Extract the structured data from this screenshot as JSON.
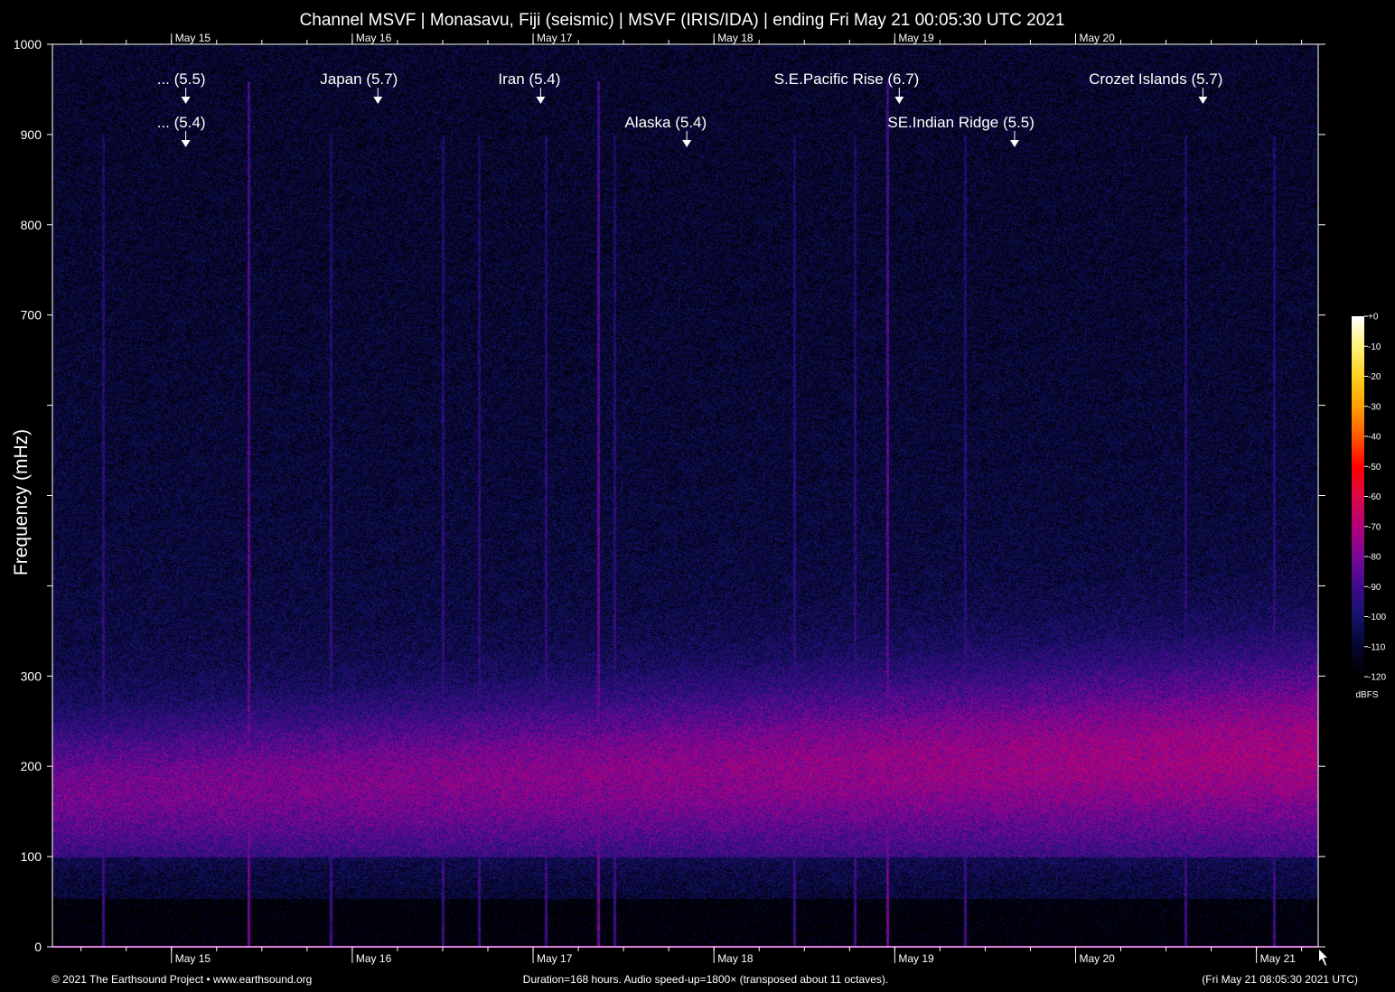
{
  "chart_data": {
    "type": "heatmap",
    "title": "Channel MSVF | Monasavu, Fiji (seismic) | MSVF (IRIS/IDA) | ending Fri May 21 00:05:30 UTC 2021",
    "xlabel": "",
    "ylabel": "Frequency (mHz)",
    "x_units": "hours since start",
    "xlim": [
      0,
      168
    ],
    "ylim": [
      0,
      1000
    ],
    "y_ticks": [
      0,
      100,
      200,
      300,
      400,
      500,
      600,
      700,
      800,
      900,
      1000
    ],
    "y_tick_labels": [
      "0",
      "100",
      "200",
      "300",
      "",
      "",
      "",
      "700",
      "800",
      "900",
      "1000"
    ],
    "x_day_ticks": [
      {
        "hour": 15.8,
        "label": "May 15"
      },
      {
        "hour": 39.8,
        "label": "May 16"
      },
      {
        "hour": 63.8,
        "label": "May 17"
      },
      {
        "hour": 87.8,
        "label": "May 18"
      },
      {
        "hour": 111.8,
        "label": "May 19"
      },
      {
        "hour": 135.8,
        "label": "May 20"
      },
      {
        "hour": 159.8,
        "label": "May 21"
      }
    ],
    "events": [
      {
        "hour": 17.7,
        "label": "... (5.5)",
        "row": 1
      },
      {
        "hour": 17.7,
        "label": "... (5.4)",
        "row": 2
      },
      {
        "hour": 43.2,
        "label": "Japan (5.7)",
        "row": 1
      },
      {
        "hour": 64.8,
        "label": "Iran (5.4)",
        "row": 1
      },
      {
        "hour": 84.2,
        "label": "Alaska (5.4)",
        "row": 2
      },
      {
        "hour": 112.4,
        "label": "S.E.Pacific Rise (6.7)",
        "row": 1
      },
      {
        "hour": 127.7,
        "label": "SE.Indian Ridge (5.5)",
        "row": 2
      },
      {
        "hour": 152.7,
        "label": "Crozet Islands (5.7)",
        "row": 1
      }
    ],
    "colorbar": {
      "label": "dBFS",
      "range": [
        -120,
        0
      ],
      "ticks": [
        "+0",
        "-10",
        "-20",
        "-30",
        "-40",
        "-50",
        "-60",
        "-70",
        "-80",
        "-90",
        "-100",
        "-110",
        "-120"
      ],
      "colors": [
        "#ffffff",
        "#fff27a",
        "#ffd21e",
        "#ffa000",
        "#ff5a00",
        "#ff0000",
        "#dc0a46",
        "#b4007a",
        "#7a0a96",
        "#400a8c",
        "#14146a",
        "#060630",
        "#000000"
      ]
    },
    "vertical_streaks_hours": [
      6.7,
      26.0,
      36.9,
      51.8,
      56.6,
      65.5,
      72.4,
      74.6,
      98.5,
      106.5,
      110.8,
      121.1,
      150.4,
      162.1
    ]
  },
  "footer": {
    "copyright": "© 2021 The Earthsound Project • www.earthsound.org",
    "info": "Duration=168 hours. Audio speed-up=1800× (transposed about 11 octaves).",
    "timestamp": "(Fri May 21 08:05:30 2021 UTC)"
  }
}
